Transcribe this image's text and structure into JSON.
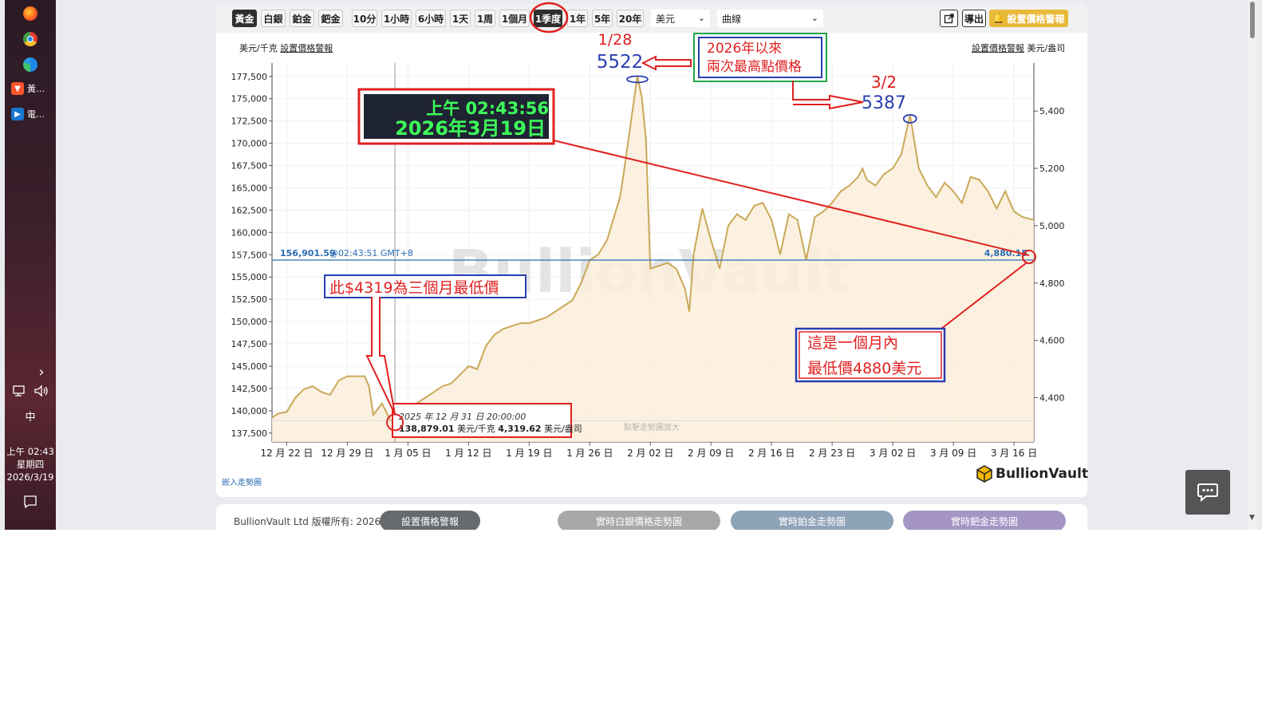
{
  "taskbar": {
    "apps": [
      {
        "label": "黃…",
        "icon": "brave-icon"
      },
      {
        "label": "電…",
        "icon": "video-icon"
      }
    ],
    "chevron": "›",
    "ime": "中",
    "clock": {
      "time": "上午 02:43",
      "weekday": "星期四",
      "date": "2026/3/19"
    }
  },
  "toolbar": {
    "metals": [
      "黃金",
      "白銀",
      "鉑金",
      "鈀金"
    ],
    "active_metal": "黃金",
    "ranges": [
      "10分",
      "1小時",
      "6小時",
      "1天",
      "1周",
      "1個月",
      "1季度",
      "1年",
      "5年",
      "20年"
    ],
    "active_range": "1季度",
    "currency": "美元",
    "chart_style": "曲線",
    "export_label": "導出",
    "alert_label": "設置價格警報"
  },
  "chart_header": {
    "left_unit": "美元/千克",
    "left_link": "設置價格警報",
    "right_link": "設置價格警報",
    "right_unit": "美元/盎司"
  },
  "chart_data": {
    "type": "area",
    "watermark": "BullionVault",
    "click_hint": "點擊走勢圖放大",
    "x_ticks": [
      "12 月 22 日",
      "12 月 29 日",
      "1 月 05 日",
      "1 月 12 日",
      "1 月 19 日",
      "1 月 26 日",
      "2 月 02 日",
      "2 月 09 日",
      "2 月 16 日",
      "2 月 23 日",
      "3 月 02 日",
      "3 月 09 日",
      "3 月 16 日"
    ],
    "y_left_ticks": [
      "137,500",
      "140,000",
      "142,500",
      "145,000",
      "147,500",
      "150,000",
      "152,500",
      "155,000",
      "157,500",
      "160,000",
      "162,500",
      "165,000",
      "167,500",
      "170,000",
      "172,500",
      "175,000",
      "177,500"
    ],
    "y_left_range": [
      136500,
      179000
    ],
    "y_right_ticks": [
      "4,400",
      "4,600",
      "4,800",
      "5,000",
      "5,200",
      "5,400"
    ],
    "y_right_range": [
      4245.6,
      5567.5
    ],
    "x_range_days": [
      -1.7,
      86.3
    ],
    "x_origin_date": "2025-12-22",
    "series": [
      {
        "unit": "美元/盎司",
        "x_days": [
          -1.7,
          -1,
          0,
          1,
          2,
          3,
          4,
          5,
          6,
          7,
          8,
          9,
          9.5,
          10,
          11,
          12,
          12.5,
          13,
          14,
          15,
          16,
          17,
          18,
          19,
          20,
          21,
          22,
          23,
          24,
          25,
          26,
          27,
          28,
          29,
          30,
          31,
          32,
          33,
          34,
          35,
          36,
          37,
          38,
          38.5,
          39,
          39.7,
          40.5,
          41,
          41.5,
          42,
          43,
          44,
          45,
          46,
          46.5,
          47,
          48,
          49,
          50,
          51,
          52,
          53,
          54,
          55,
          56,
          57,
          58,
          59,
          60,
          61,
          62,
          63,
          64,
          65,
          66,
          66.5,
          67,
          68,
          69,
          70,
          71,
          72,
          73,
          74,
          75,
          76,
          77,
          78,
          79,
          80,
          81,
          82,
          83,
          84,
          85,
          86.3
        ],
        "values": [
          4330,
          4345,
          4350,
          4400,
          4430,
          4440,
          4420,
          4410,
          4460,
          4475,
          4475,
          4475,
          4440,
          4340,
          4380,
          4320,
          4319.6,
          4345,
          4360,
          4380,
          4400,
          4420,
          4440,
          4450,
          4480,
          4510,
          4500,
          4580,
          4620,
          4640,
          4650,
          4660,
          4660,
          4670,
          4680,
          4700,
          4720,
          4740,
          4800,
          4880,
          4900,
          4950,
          5050,
          5100,
          5200,
          5350,
          5522,
          5450,
          5300,
          4850,
          4860,
          4870,
          4850,
          4780,
          4700,
          4900,
          5060,
          4950,
          4850,
          5000,
          5040,
          5020,
          5070,
          5080,
          5020,
          4900,
          5040,
          5020,
          4880,
          5030,
          5050,
          5080,
          5120,
          5140,
          5170,
          5200,
          5160,
          5140,
          5180,
          5200,
          5250,
          5387,
          5200,
          5140,
          5100,
          5150,
          5120,
          5080,
          5170,
          5160,
          5120,
          5060,
          5120,
          5050,
          5030,
          5020,
          4880
        ]
      }
    ],
    "current_line": {
      "value_kg": "156,901.59",
      "time": "@02:43:51 GMT+8",
      "value_oz": "4,880.15"
    },
    "tooltip": {
      "date": "2025 年 12 月 31 日 20:00:00",
      "kg_value": "138,879.01",
      "kg_unit": "美元/千克",
      "oz_value": "4,319.62",
      "oz_unit": "美元/盎司"
    }
  },
  "annotations": {
    "peak1_date": "1/28",
    "peak1_value": "5522",
    "peak2_date": "3/2",
    "peak2_value": "5387",
    "peaks_title_line1": "2026年以來",
    "peaks_title_line2": "兩次最高點價格",
    "datetime_time": "上午 02:43:56",
    "datetime_date": "2026年3月19日",
    "low_label": "此$4319為三個月最低價",
    "month_low_line1": "這是一個月內",
    "month_low_line2": "最低價4880美元"
  },
  "embed_link": "嵌入走勢圖",
  "logo": "BullionVault",
  "footer": {
    "copyright": "BullionVault Ltd 版權所有: 2026",
    "buttons": [
      "設置價格警報",
      "實時白銀價格走勢圖",
      "實時鉑金走勢圖",
      "實時鈀金走勢圖"
    ]
  },
  "colors": {
    "area_line": "#c9a858",
    "area_fill": "#fbeeda",
    "current_line": "#2a6db5",
    "annotation_red": "#e02020",
    "annotation_blue": "#2a3fb0",
    "alert_gold": "#e8b93a"
  }
}
